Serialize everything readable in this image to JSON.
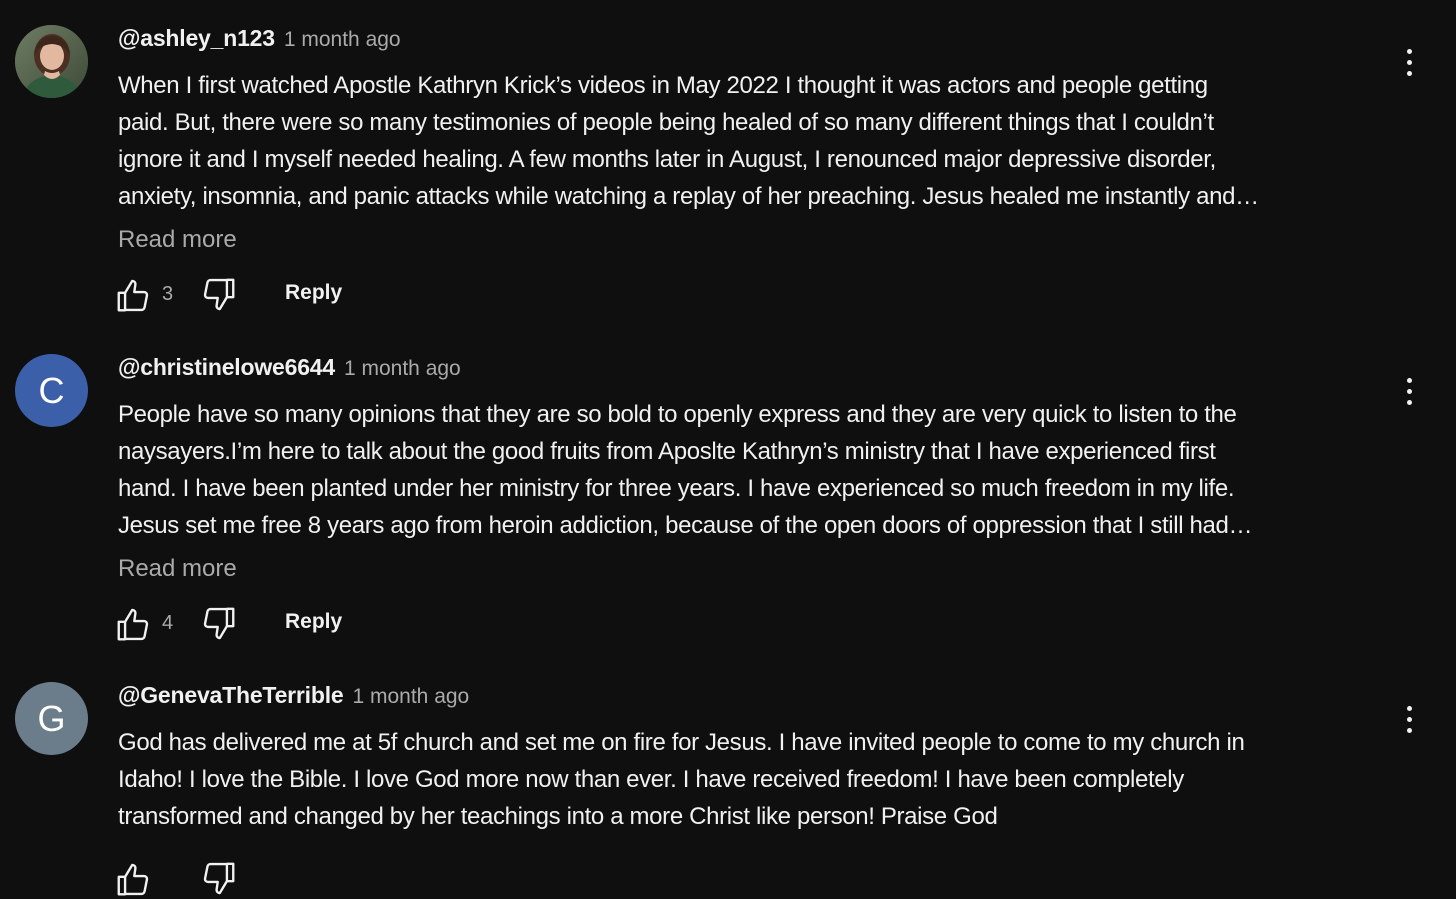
{
  "icons": {
    "like": "thumb-up-icon",
    "dislike": "thumb-down-icon",
    "more": "more-vertical-icon"
  },
  "colors": {
    "background": "#0f0f0f",
    "text": "#f1f1f1",
    "secondary_text": "#aaaaaa",
    "avatar_c": "#3b5fa8",
    "avatar_g": "#6b7d8b"
  },
  "comments": [
    {
      "avatar_letter": "",
      "handle": "@ashley_n123",
      "time": "1 month ago",
      "lines": [
        "When I first watched Apostle Kathryn Krick’s videos in May 2022 I thought it was actors and people getting",
        "paid. But, there were so many testimonies of people being healed of so many different things that I couldn’t",
        "ignore it and I myself needed healing. A few months later in August, I renounced major depressive disorder,",
        "anxiety, insomnia, and panic attacks while watching a replay of her preaching. Jesus healed me instantly and…"
      ],
      "read_more": "Read more",
      "likes": "3",
      "reply": "Reply"
    },
    {
      "avatar_letter": "C",
      "handle": "@christinelowe6644",
      "time": "1 month ago",
      "lines": [
        "People have so many opinions that they are so bold to openly express and they are very quick to listen to the",
        "naysayers.I’m here to talk about the good fruits from Aposlte Kathryn’s ministry that I have experienced first",
        "hand. I have been planted under her ministry for three years. I have experienced so much freedom in my life.",
        "Jesus set me free 8 years ago from heroin addiction, because of the open doors of oppression that I still had…"
      ],
      "read_more": "Read more",
      "likes": "4",
      "reply": "Reply"
    },
    {
      "avatar_letter": "G",
      "handle": "@GenevaTheTerrible",
      "time": "1 month ago",
      "lines": [
        "God has delivered me at 5f church and set me on fire for Jesus. I have invited people to come to my church in",
        "Idaho! I love the Bible. I love God more now than ever. I have received freedom! I have been completely",
        "transformed and changed by her teachings into a more Christ like person! Praise God"
      ]
    }
  ]
}
